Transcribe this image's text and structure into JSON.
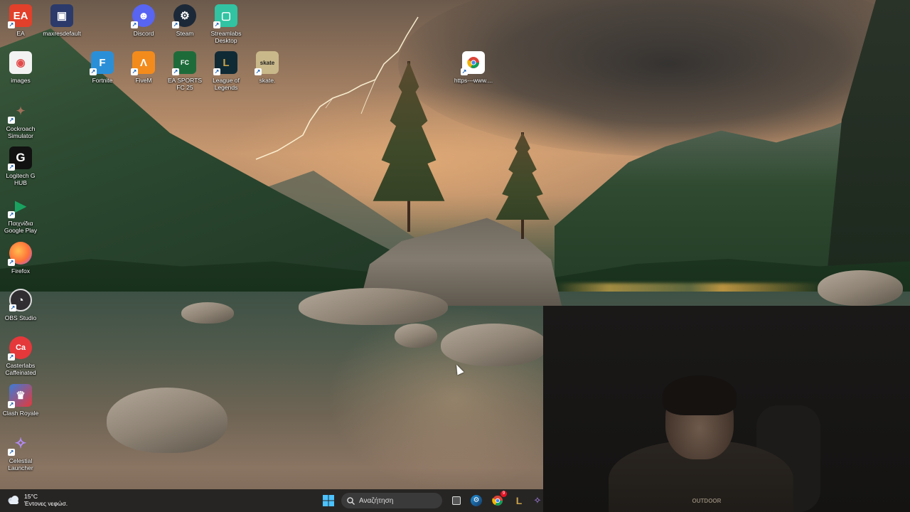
{
  "desktop": {
    "icons": [
      {
        "label": "EA",
        "icon": "ea-icon",
        "color": "#e2402a"
      },
      {
        "label": "maxresdefault",
        "icon": "image-file-icon",
        "color": "#2b3a6b"
      },
      {
        "label": "Discord",
        "icon": "discord-icon",
        "color": "#5865f2"
      },
      {
        "label": "Steam",
        "icon": "steam-icon",
        "color": "#1b2838"
      },
      {
        "label": "Streamlabs Desktop",
        "icon": "streamlabs-icon",
        "color": "#31c3a2"
      },
      {
        "label": "images",
        "icon": "image-file-icon",
        "color": "#e34a4a"
      },
      {
        "label": "Fortnite",
        "icon": "fortnite-icon",
        "color": "#2b8fd8"
      },
      {
        "label": "FiveM",
        "icon": "fivem-icon",
        "color": "#f38b1c"
      },
      {
        "label": "EA SPORTS FC 25",
        "icon": "ea-sports-fc-icon",
        "color": "#1e6b3a"
      },
      {
        "label": "League of Legends",
        "icon": "league-of-legends-icon",
        "color": "#0f2a35"
      },
      {
        "label": "skate.",
        "icon": "skate-icon",
        "color": "#c9b88a"
      },
      {
        "label": "https---www....",
        "icon": "chrome-shortcut-icon",
        "color": "#ffffff"
      },
      {
        "label": "Cockroach Simulator",
        "icon": "cockroach-simulator-icon",
        "color": "#6b4a3a"
      },
      {
        "label": "Logitech G HUB",
        "icon": "logitech-g-hub-icon",
        "color": "#111111"
      },
      {
        "label": "Παιχνίδια Google Play",
        "icon": "google-play-games-icon",
        "color": "#1aa260"
      },
      {
        "label": "Firefox",
        "icon": "firefox-icon",
        "color": "#ff7139"
      },
      {
        "label": "OBS Studio",
        "icon": "obs-studio-icon",
        "color": "#302e31"
      },
      {
        "label": "Casterlabs Caffeinated",
        "icon": "casterlabs-icon",
        "color": "#e5383b"
      },
      {
        "label": "Clash Royale",
        "icon": "clash-royale-icon",
        "color": "#3b7bd8"
      },
      {
        "label": "Celestial Launcher",
        "icon": "celestial-launcher-icon",
        "color": "#6a3fc9"
      }
    ]
  },
  "webcam": {
    "shirt_text": "OUTDOOR"
  },
  "taskbar": {
    "weather": {
      "temperature": "15°C",
      "condition": "Έντονες νεφώσ."
    },
    "search": {
      "placeholder": "Αναζήτηση"
    },
    "pinned": [
      "start-button",
      "search",
      "task-view",
      "steam",
      "chrome",
      "league-of-legends",
      "celestial-launcher"
    ],
    "chrome_badge": "9"
  }
}
